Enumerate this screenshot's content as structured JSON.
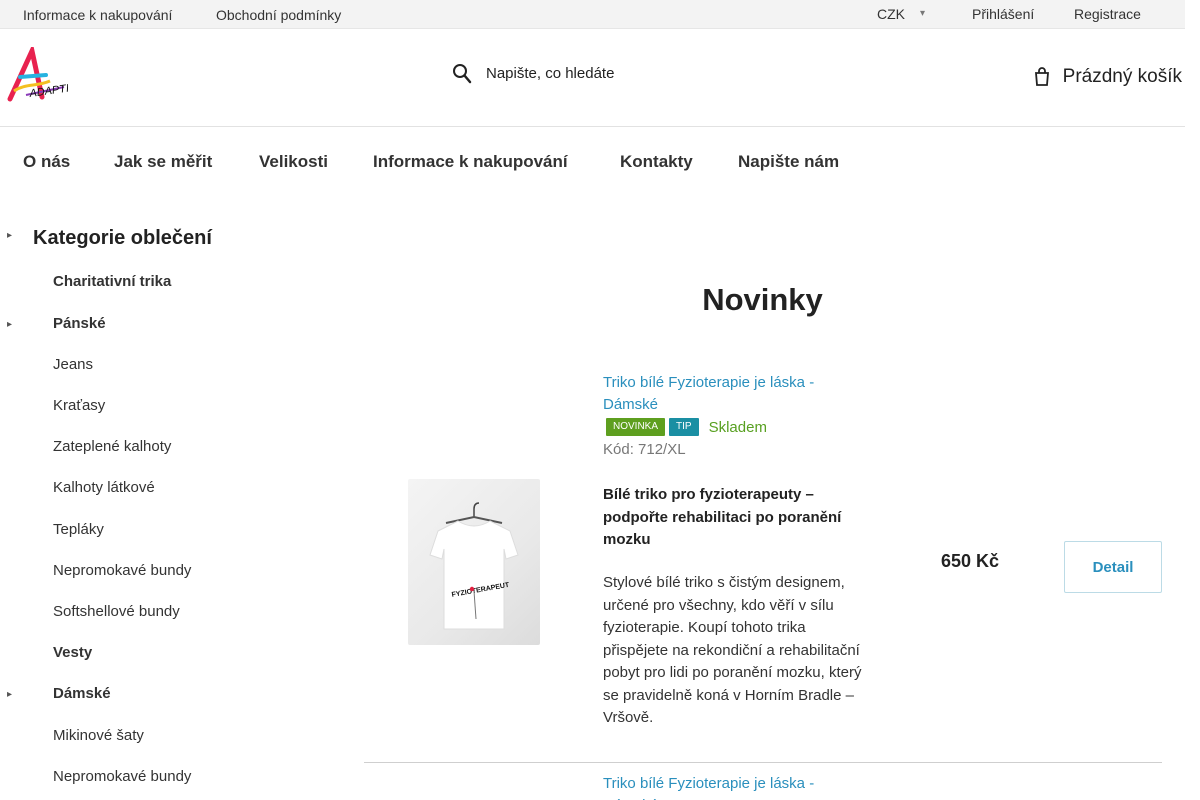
{
  "topbar": {
    "links": [
      "Informace k nakupování",
      "Obchodní podmínky"
    ],
    "currency": "CZK",
    "login": "Přihlášení",
    "register": "Registrace"
  },
  "header": {
    "logo_text": "ADAPTIA",
    "search_placeholder": "Napište, co hledáte",
    "cart_label": "Prázdný košík"
  },
  "nav": [
    "O nás",
    "Jak se měřit",
    "Velikosti",
    "Informace k nakupování",
    "Kontakty",
    "Napište nám"
  ],
  "sidebar": {
    "title": "Kategorie oblečení",
    "items": [
      {
        "label": "Charitativní trika",
        "bold": true
      },
      {
        "label": "Pánské",
        "bold": true,
        "expandable": true
      },
      {
        "label": "Jeans",
        "bold": false
      },
      {
        "label": "Kraťasy",
        "bold": false
      },
      {
        "label": "Zateplené kalhoty",
        "bold": false
      },
      {
        "label": "Kalhoty látkové",
        "bold": false
      },
      {
        "label": "Tepláky",
        "bold": false
      },
      {
        "label": "Nepromokavé bundy",
        "bold": false
      },
      {
        "label": "Softshellové bundy",
        "bold": false
      },
      {
        "label": "Vesty",
        "bold": true
      },
      {
        "label": "Dámské",
        "bold": true,
        "expandable": true
      },
      {
        "label": "Mikinové šaty",
        "bold": false
      },
      {
        "label": "Nepromokavé bundy",
        "bold": false
      }
    ]
  },
  "main": {
    "title": "Novinky",
    "products": [
      {
        "name": "Triko bílé Fyzioterapie je láska - Dámské",
        "badges": [
          "NOVINKA",
          "TIP"
        ],
        "stock": "Skladem",
        "code": "Kód: 712/XL",
        "headline": "Bílé triko pro fyzioterapeuty – podpořte rehabilitaci po poranění mozku",
        "description": "Stylové bílé triko s čistým designem, určené pro všechny, kdo věří v sílu fyzioterapie. Koupí tohoto trika přispějete na rekondiční a rehabilitační pobyt pro lidi po poranění mozku, který se pravidelně koná v Horním Bradle – Vršově.",
        "image_text": "FYZIOTERAPEUT",
        "price": "650 Kč",
        "button": "Detail"
      },
      {
        "name": "Triko bílé Fyzioterapie je láska - Dámské"
      }
    ]
  },
  "colors": {
    "link": "#2a8fbd",
    "badge_new": "#5e9f1f",
    "badge_tip": "#1a8fa3",
    "stock": "#58a021"
  }
}
